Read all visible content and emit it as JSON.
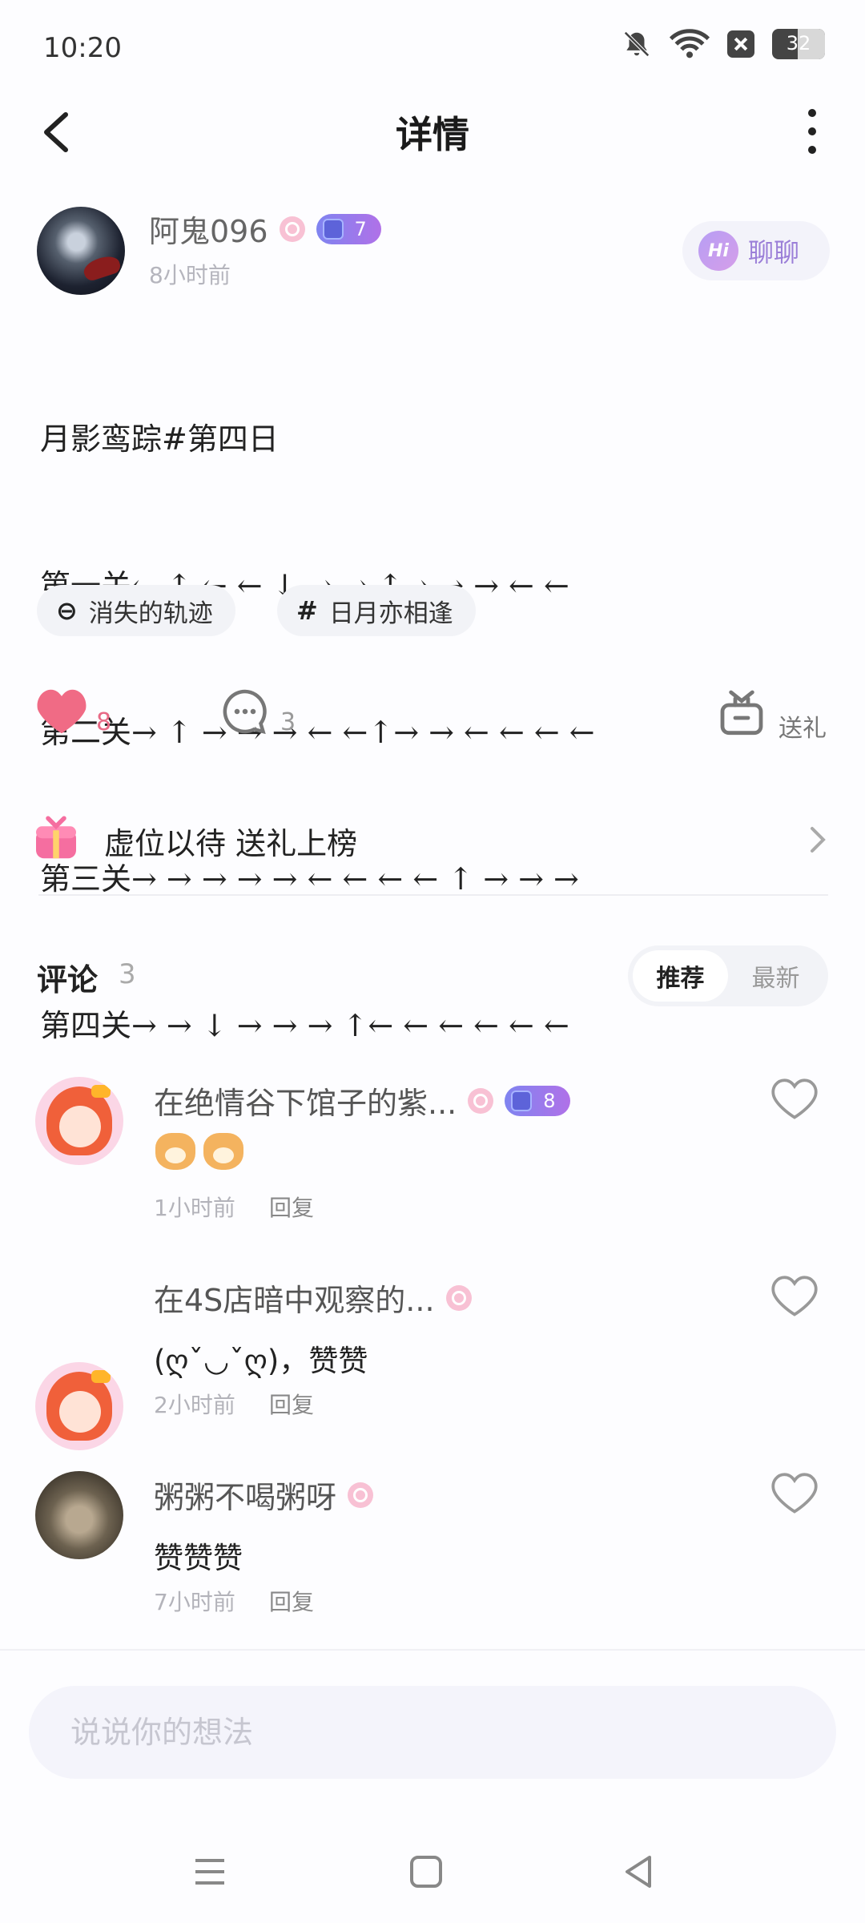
{
  "status_bar": {
    "time": "10:20",
    "battery": "32",
    "icons": [
      "mute-icon",
      "wifi-icon",
      "x-box-icon",
      "battery-icon"
    ]
  },
  "header": {
    "title": "详情"
  },
  "author": {
    "name": "阿鬼096",
    "time": "8小时前",
    "level": "7",
    "chat_label": "聊聊",
    "chat_icon": "Hi"
  },
  "post": {
    "lines": [
      "月影鸾踪#第四日",
      "第一关← ↑ ← ← ↓ → → ↑→ → → ← ←",
      "第二关→ ↑ → → → ← ←↑→ → ← ← ← ←",
      "第三关→ → → → → ← ← ← ← ↑ → → →",
      "第四关→ → ↓ → → → ↑← ← ← ← ← ←"
    ],
    "topics": [
      {
        "symbol": "⊖",
        "label": "消失的轨迹"
      },
      {
        "symbol": "#",
        "label": "日月亦相逢"
      }
    ]
  },
  "actions": {
    "likes": "8",
    "comments": "3",
    "gift_label": "送礼"
  },
  "rank": {
    "text": "虚位以待 送礼上榜"
  },
  "comments_section": {
    "title": "评论",
    "count": "3",
    "sort_options": [
      "推荐",
      "最新"
    ],
    "active_sort": "推荐",
    "items": [
      {
        "name": "在绝情谷下馆子的紫...",
        "level": "8",
        "text": "",
        "time": "1小时前",
        "reply": "回复"
      },
      {
        "name": "在4S店暗中观察的...",
        "text": "(ღˇ◡ˇღ)，赞赞",
        "time": "2小时前",
        "reply": "回复"
      },
      {
        "name": "粥粥不喝粥呀",
        "text": "赞赞赞",
        "time": "7小时前",
        "reply": "回复"
      }
    ]
  },
  "input": {
    "placeholder": "说说你的想法"
  },
  "colors": {
    "accent": "#9b7fd8",
    "like": "#f06b85",
    "level_gradient_start": "#7f84f0",
    "level_gradient_end": "#b071e8"
  }
}
